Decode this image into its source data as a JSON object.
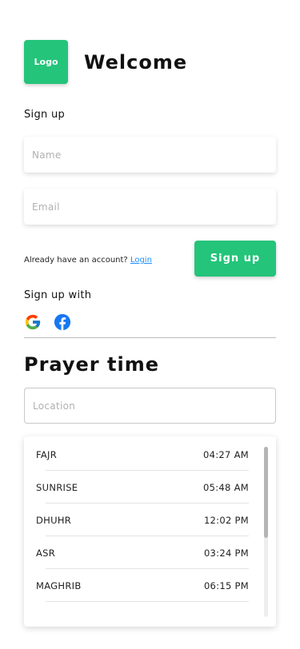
{
  "header": {
    "logo_text": "Logo",
    "title": "Welcome"
  },
  "signup": {
    "section_label": "Sign up",
    "name_placeholder": "Name",
    "email_placeholder": "Email",
    "already_text": "Already have an account?",
    "login_link": "Login",
    "button_label": "Sign up",
    "social_label": "Sign up with",
    "social_icons": [
      "google-icon",
      "facebook-icon"
    ]
  },
  "prayer": {
    "title": "Prayer time",
    "location_placeholder": "Location",
    "times": [
      {
        "name": "FAJR",
        "time": "04:27 AM"
      },
      {
        "name": "SUNRISE",
        "time": "05:48 AM"
      },
      {
        "name": "DHUHR",
        "time": "12:02 PM"
      },
      {
        "name": "ASR",
        "time": "03:24 PM"
      },
      {
        "name": "MAGHRIB",
        "time": "06:15 PM"
      }
    ]
  },
  "colors": {
    "accent": "#24c47a",
    "link": "#1e90ff",
    "google_blue": "#4285F4",
    "google_red": "#EA4335",
    "google_yellow": "#FBBC05",
    "google_green": "#34A853",
    "facebook": "#1877F2"
  }
}
